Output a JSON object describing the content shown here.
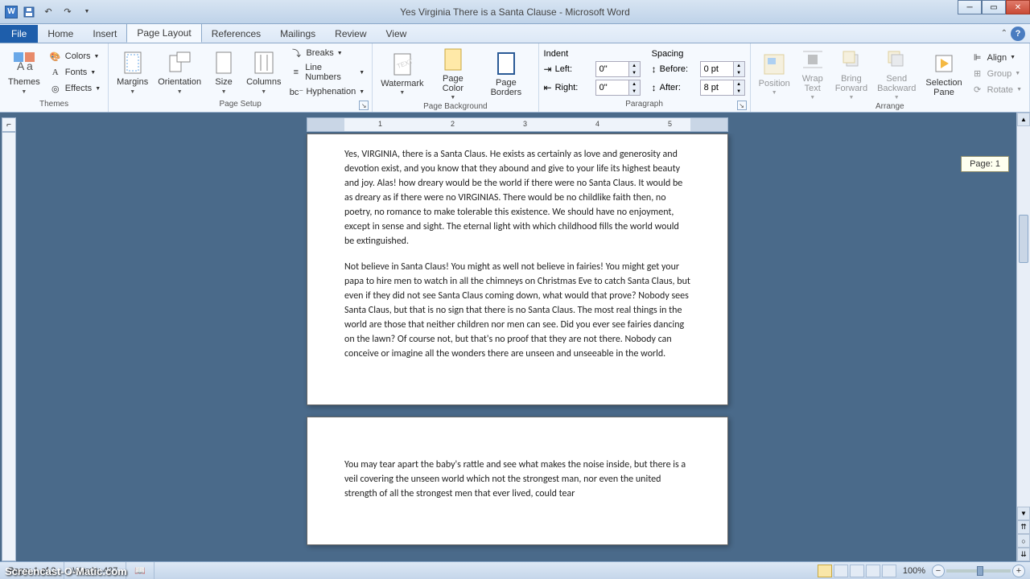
{
  "window": {
    "title": "Yes Virginia There is a Santa Clause - Microsoft Word",
    "app_letter": "W"
  },
  "tabs": {
    "file": "File",
    "items": [
      "Home",
      "Insert",
      "Page Layout",
      "References",
      "Mailings",
      "Review",
      "View"
    ],
    "active_index": 2
  },
  "ribbon": {
    "themes": {
      "main": "Themes",
      "colors": "Colors",
      "fonts": "Fonts",
      "effects": "Effects",
      "label": "Themes"
    },
    "page_setup": {
      "margins": "Margins",
      "orientation": "Orientation",
      "size": "Size",
      "columns": "Columns",
      "breaks": "Breaks",
      "line_numbers": "Line Numbers",
      "hyphenation": "Hyphenation",
      "label": "Page Setup"
    },
    "page_bg": {
      "watermark": "Watermark",
      "page_color": "Page Color",
      "page_borders": "Page Borders",
      "label": "Page Background"
    },
    "paragraph": {
      "indent": "Indent",
      "spacing": "Spacing",
      "left": "Left:",
      "right": "Right:",
      "before": "Before:",
      "after": "After:",
      "left_val": "0\"",
      "right_val": "0\"",
      "before_val": "0 pt",
      "after_val": "8 pt",
      "label": "Paragraph"
    },
    "arrange": {
      "position": "Position",
      "wrap": "Wrap Text",
      "forward": "Bring Forward",
      "backward": "Send Backward",
      "pane": "Selection Pane",
      "align": "Align",
      "group": "Group",
      "rotate": "Rotate",
      "label": "Arrange"
    }
  },
  "page_tooltip": "Page: 1",
  "document": {
    "para1": "Yes, VIRGINIA, there is a Santa Claus. He exists as certainly as love and generosity and devotion exist, and you know that they abound and give to your life its highest beauty and joy. Alas! how dreary would be the world if there were no Santa Claus. It would be as dreary as if there were no VIRGINIAS. There would be no childlike faith then, no poetry, no romance to make tolerable this existence. We should have no enjoyment, except in sense and sight. The eternal light with which childhood fills the world would be extinguished.",
    "para2": "Not believe in Santa Claus! You might as well not believe in fairies! You might get your papa to hire men to watch in all the chimneys on Christmas Eve to catch Santa Claus, but even if they did not see Santa Claus coming down, what would that prove? Nobody sees Santa Claus, but that is no sign that there is no Santa Claus. The most real things in the world are those that neither children nor men can see. Did you ever see fairies dancing on the lawn? Of course not, but that's no proof that they are not there. Nobody can conceive or imagine all the wonders there are unseen and unseeable in the world.",
    "para3": "You may tear apart the baby's rattle and see what makes the noise inside, but there is a veil covering the unseen world which not the strongest man, nor even the united strength of all the strongest men that ever lived, could tear"
  },
  "ruler_marks": [
    "1",
    "2",
    "3",
    "4",
    "5"
  ],
  "status": {
    "page": "Page: 1 of 2",
    "words": "Words: 427",
    "zoom": "100%"
  },
  "watermark": "Screencast-O-Matic.com"
}
